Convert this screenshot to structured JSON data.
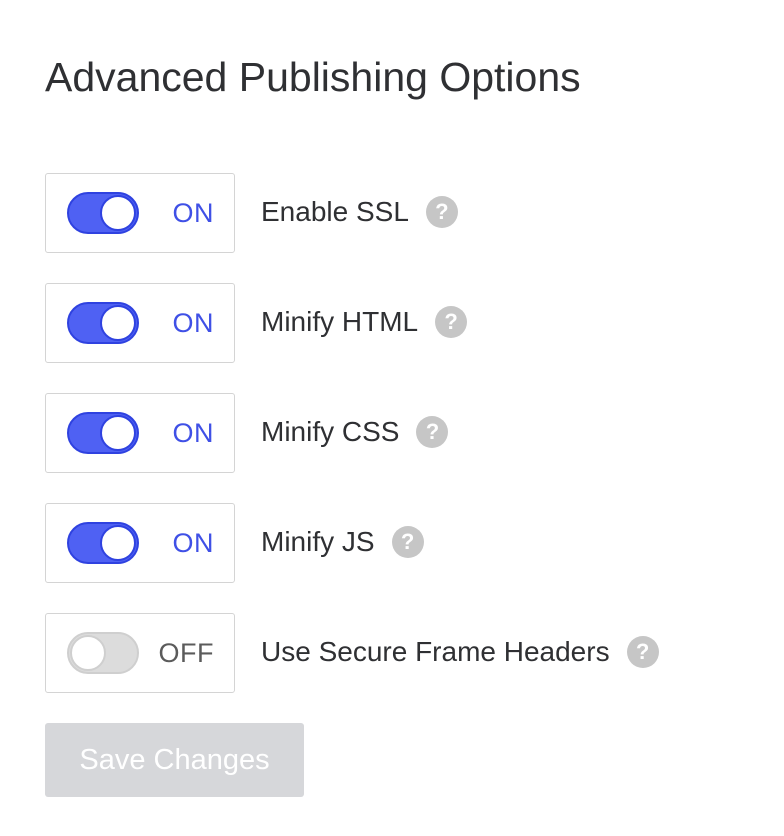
{
  "page": {
    "title": "Advanced Publishing Options"
  },
  "options": [
    {
      "label": "Enable SSL",
      "state": "ON",
      "enabled": true,
      "help_icon": "question-circle-icon"
    },
    {
      "label": "Minify HTML",
      "state": "ON",
      "enabled": true,
      "help_icon": "question-circle-icon"
    },
    {
      "label": "Minify CSS",
      "state": "ON",
      "enabled": true,
      "help_icon": "question-circle-icon"
    },
    {
      "label": "Minify JS",
      "state": "ON",
      "enabled": true,
      "help_icon": "question-circle-icon"
    },
    {
      "label": "Use Secure Frame Headers",
      "state": "OFF",
      "enabled": false,
      "help_icon": "question-circle-icon"
    }
  ],
  "help_glyph": "?",
  "actions": {
    "save_label": "Save Changes",
    "save_disabled": true
  },
  "colors": {
    "accent": "#4f61f3",
    "accent_text": "#3f50e6",
    "off_track": "#dcdcdc",
    "help_icon_bg": "#c6c6c6",
    "disabled_button_bg": "#d6d7da"
  }
}
